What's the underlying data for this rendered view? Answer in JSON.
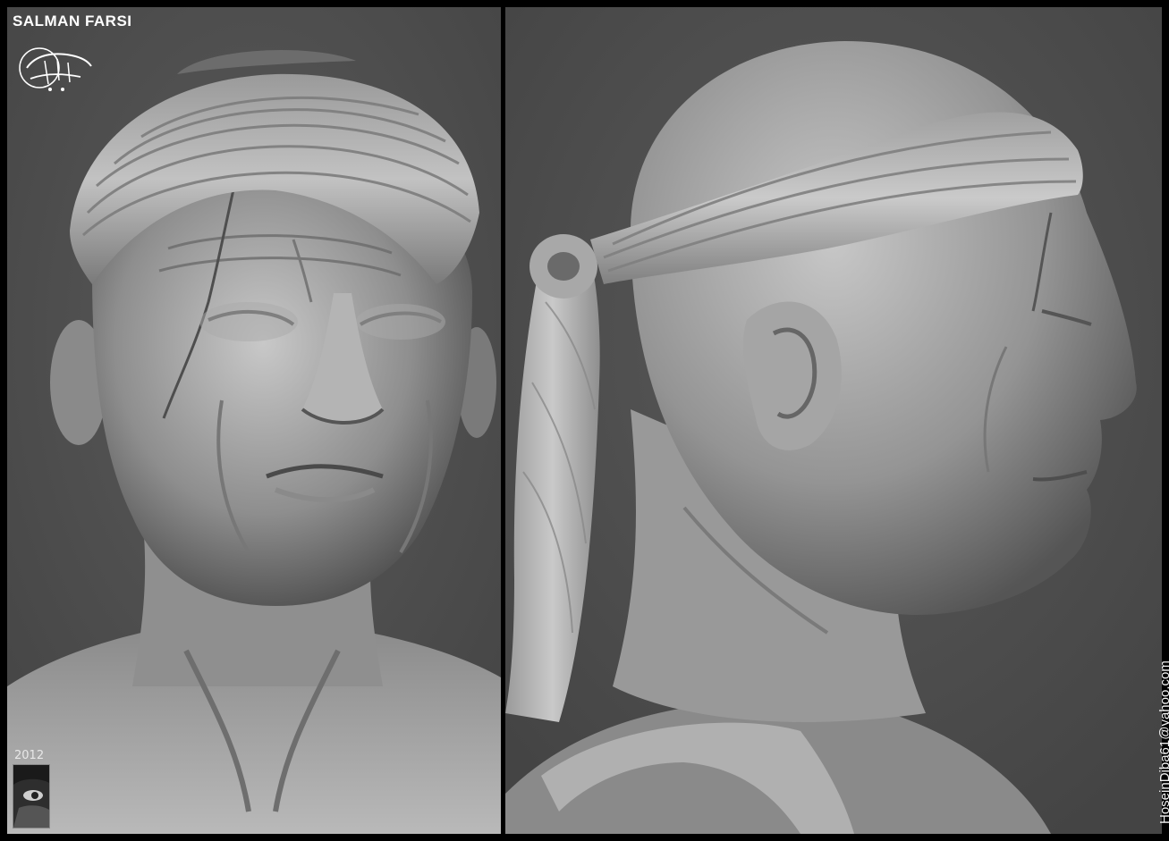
{
  "artwork": {
    "title": "SALMAN FARSI",
    "year": "2012",
    "contact": "HoseinDiba61@yahoo.com",
    "logo_icon": "calligraphy-logo-icon",
    "thumbnail_icon": "artist-portrait-icon",
    "colors": {
      "border": "#000000",
      "background": "#505050",
      "sculpt_light": "#c9c9c9",
      "sculpt_shadow": "#3a3a3a",
      "text": "#ffffff"
    }
  },
  "views": [
    {
      "subject": "front-view-sculpt"
    },
    {
      "subject": "side-profile-sculpt"
    }
  ]
}
